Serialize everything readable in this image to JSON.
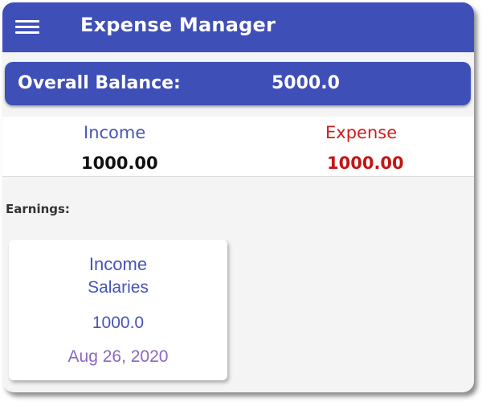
{
  "appbar": {
    "title": "Expense Manager",
    "menu_icon": "hamburger-menu-icon"
  },
  "balance": {
    "label": "Overall Balance:",
    "value": "5000.0"
  },
  "summary": {
    "income_label": "Income",
    "income_value": "1000.00",
    "expense_label": "Expense",
    "expense_value": "1000.00"
  },
  "earnings": {
    "title": "Earnings:",
    "items": [
      {
        "type": "Income",
        "category": "Salaries",
        "amount": "1000.0",
        "date": "Aug 26, 2020"
      }
    ]
  },
  "colors": {
    "primary": "#3f4fb8",
    "income_text": "#4655b5",
    "expense_text": "#d11c1c",
    "date_text": "#8a68c0"
  }
}
